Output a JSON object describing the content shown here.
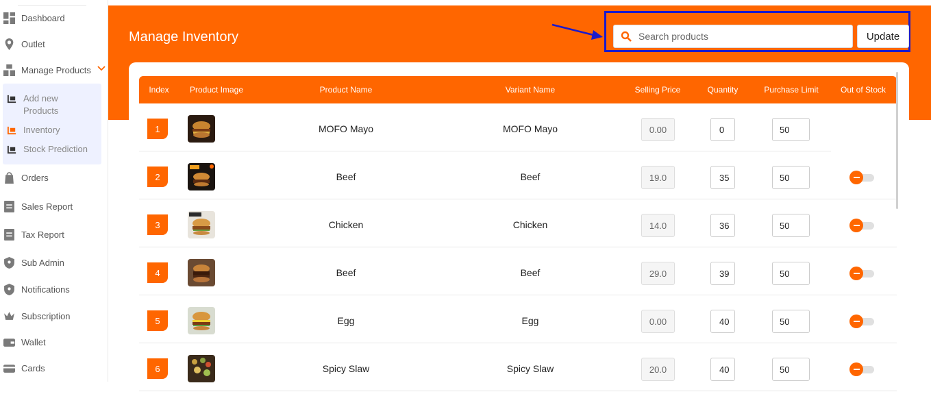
{
  "sidebar": {
    "items": [
      {
        "label": "Dashboard",
        "icon": "dashboard-icon"
      },
      {
        "label": "Outlet",
        "icon": "location-pin-icon"
      },
      {
        "label": "Manage Products",
        "icon": "boxes-icon"
      },
      {
        "label": "Orders",
        "icon": "clipboard-bag-icon"
      },
      {
        "label": "Sales Report",
        "icon": "report-icon"
      },
      {
        "label": "Tax Report",
        "icon": "report-icon"
      },
      {
        "label": "Sub Admin",
        "icon": "shield-user-icon"
      },
      {
        "label": "Notifications",
        "icon": "shield-user-icon"
      },
      {
        "label": "Subscription",
        "icon": "crown-icon"
      },
      {
        "label": "Wallet",
        "icon": "wallet-icon"
      },
      {
        "label": "Cards",
        "icon": "card-icon"
      }
    ],
    "submenu": [
      {
        "label": "Add new Products",
        "icon": "cart-icon",
        "active": false
      },
      {
        "label": "Inventory",
        "icon": "cart-icon",
        "active": true
      },
      {
        "label": "Stock Prediction",
        "icon": "cart-icon",
        "active": false
      }
    ]
  },
  "header": {
    "title": "Manage Inventory",
    "search_placeholder": "Search products",
    "update_label": "Update"
  },
  "colors": {
    "accent": "#ff6600",
    "highlight": "#1a1acc"
  },
  "table": {
    "columns": [
      "Index",
      "Product Image",
      "Product Name",
      "Variant Name",
      "Selling Price",
      "Quantity",
      "Purchase Limit",
      "Out of Stock"
    ],
    "rows": [
      {
        "index": "1",
        "product": "MOFO Mayo",
        "variant": "MOFO Mayo",
        "price": "0.00",
        "qty": "0",
        "limit": "50",
        "has_toggle": false
      },
      {
        "index": "2",
        "product": "Beef",
        "variant": "Beef",
        "price": "19.0",
        "qty": "35",
        "limit": "50",
        "has_toggle": true
      },
      {
        "index": "3",
        "product": "Chicken",
        "variant": "Chicken",
        "price": "14.0",
        "qty": "36",
        "limit": "50",
        "has_toggle": true
      },
      {
        "index": "4",
        "product": "Beef",
        "variant": "Beef",
        "price": "29.0",
        "qty": "39",
        "limit": "50",
        "has_toggle": true
      },
      {
        "index": "5",
        "product": "Egg",
        "variant": "Egg",
        "price": "0.00",
        "qty": "40",
        "limit": "50",
        "has_toggle": true
      },
      {
        "index": "6",
        "product": "Spicy Slaw",
        "variant": "Spicy Slaw",
        "price": "20.0",
        "qty": "40",
        "limit": "50",
        "has_toggle": true
      }
    ]
  }
}
